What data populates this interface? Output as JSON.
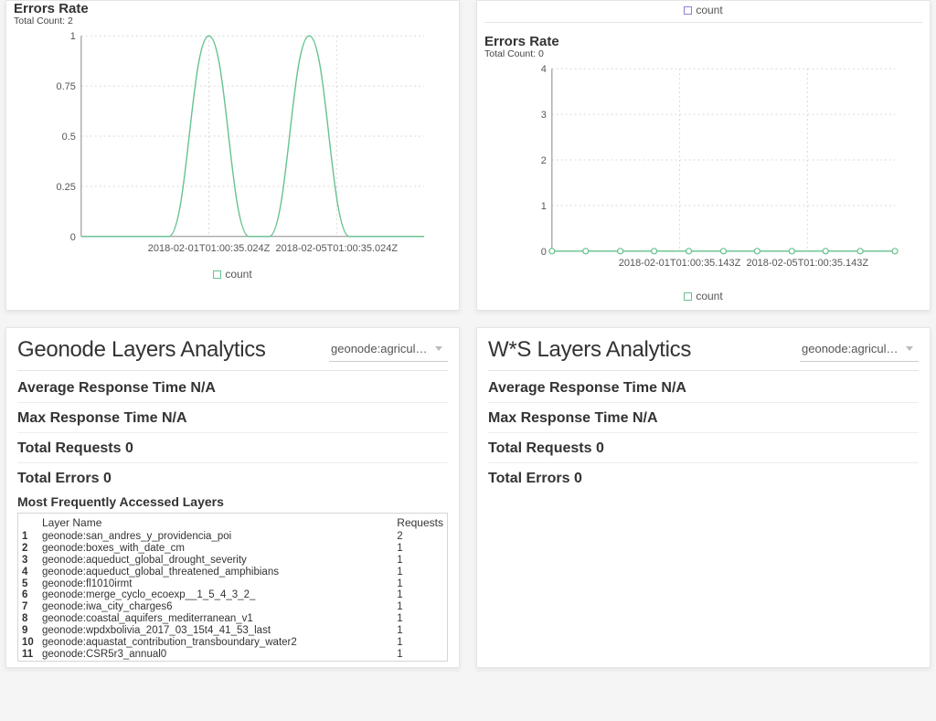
{
  "top_row": {
    "left": {
      "title": "Errors Rate",
      "subtitle": "Total Count: 2",
      "legend": "count",
      "xticks": [
        "2018-02-01T01:00:35.024Z",
        "2018-02-05T01:00:35.024Z"
      ],
      "yticks": [
        "0",
        "0.25",
        "0.5",
        "0.75",
        "1"
      ]
    },
    "right": {
      "top_legend": "count",
      "title": "Errors Rate",
      "subtitle": "Total Count: 0",
      "legend": "count",
      "xticks": [
        "2018-02-01T01:00:35.143Z",
        "2018-02-05T01:00:35.143Z"
      ],
      "yticks": [
        "0",
        "1",
        "2",
        "3",
        "4"
      ]
    }
  },
  "chart_data": [
    {
      "type": "line",
      "title": "Errors Rate",
      "series_name": "count",
      "x": [
        1,
        2,
        3,
        4,
        5,
        6,
        7,
        8,
        9,
        10,
        11
      ],
      "y": [
        0,
        0,
        0,
        0,
        1,
        0,
        0,
        1,
        0,
        0,
        0
      ],
      "xlabels": [
        "2018-02-01T01:00:35.024Z",
        "2018-02-05T01:00:35.024Z"
      ],
      "ylim": [
        0,
        1
      ]
    },
    {
      "type": "line",
      "title": "Errors Rate",
      "series_name": "count",
      "x": [
        1,
        2,
        3,
        4,
        5,
        6,
        7,
        8,
        9,
        10,
        11
      ],
      "y": [
        0,
        0,
        0,
        0,
        0,
        0,
        0,
        0,
        0,
        0,
        0
      ],
      "xlabels": [
        "2018-02-01T01:00:35.143Z",
        "2018-02-05T01:00:35.143Z"
      ],
      "ylim": [
        0,
        4
      ]
    }
  ],
  "geonode": {
    "title": "Geonode Layers Analytics",
    "selector": "geonode:agricul…",
    "avg_rt": "Average Response Time N/A",
    "max_rt": "Max Response Time N/A",
    "total_req": "Total Requests 0",
    "total_err": "Total Errors 0",
    "section": "Most Frequently Accessed Layers",
    "th1": "Layer Name",
    "th2": "Requests",
    "rows": [
      {
        "n": "1",
        "name": "geonode:san_andres_y_providencia_poi",
        "r": "2"
      },
      {
        "n": "2",
        "name": "geonode:boxes_with_date_cm",
        "r": "1"
      },
      {
        "n": "3",
        "name": "geonode:aqueduct_global_drought_severity",
        "r": "1"
      },
      {
        "n": "4",
        "name": "geonode:aqueduct_global_threatened_amphibians",
        "r": "1"
      },
      {
        "n": "5",
        "name": "geonode:fl1010irmt",
        "r": "1"
      },
      {
        "n": "6",
        "name": "geonode:merge_cyclo_ecoexp__1_5_4_3_2_",
        "r": "1"
      },
      {
        "n": "7",
        "name": "geonode:iwa_city_charges6",
        "r": "1"
      },
      {
        "n": "8",
        "name": "geonode:coastal_aquifers_mediterranean_v1",
        "r": "1"
      },
      {
        "n": "9",
        "name": "geonode:wpdxbolivia_2017_03_15t4_41_53_last",
        "r": "1"
      },
      {
        "n": "10",
        "name": "geonode:aquastat_contribution_transboundary_water2",
        "r": "1"
      },
      {
        "n": "11",
        "name": "geonode:CSR5r3_annual0",
        "r": "1"
      }
    ]
  },
  "ws": {
    "title": "W*S Layers Analytics",
    "selector": "geonode:agricul…",
    "avg_rt": "Average Response Time N/A",
    "max_rt": "Max Response Time N/A",
    "total_req": "Total Requests 0",
    "total_err": "Total Errors 0"
  }
}
